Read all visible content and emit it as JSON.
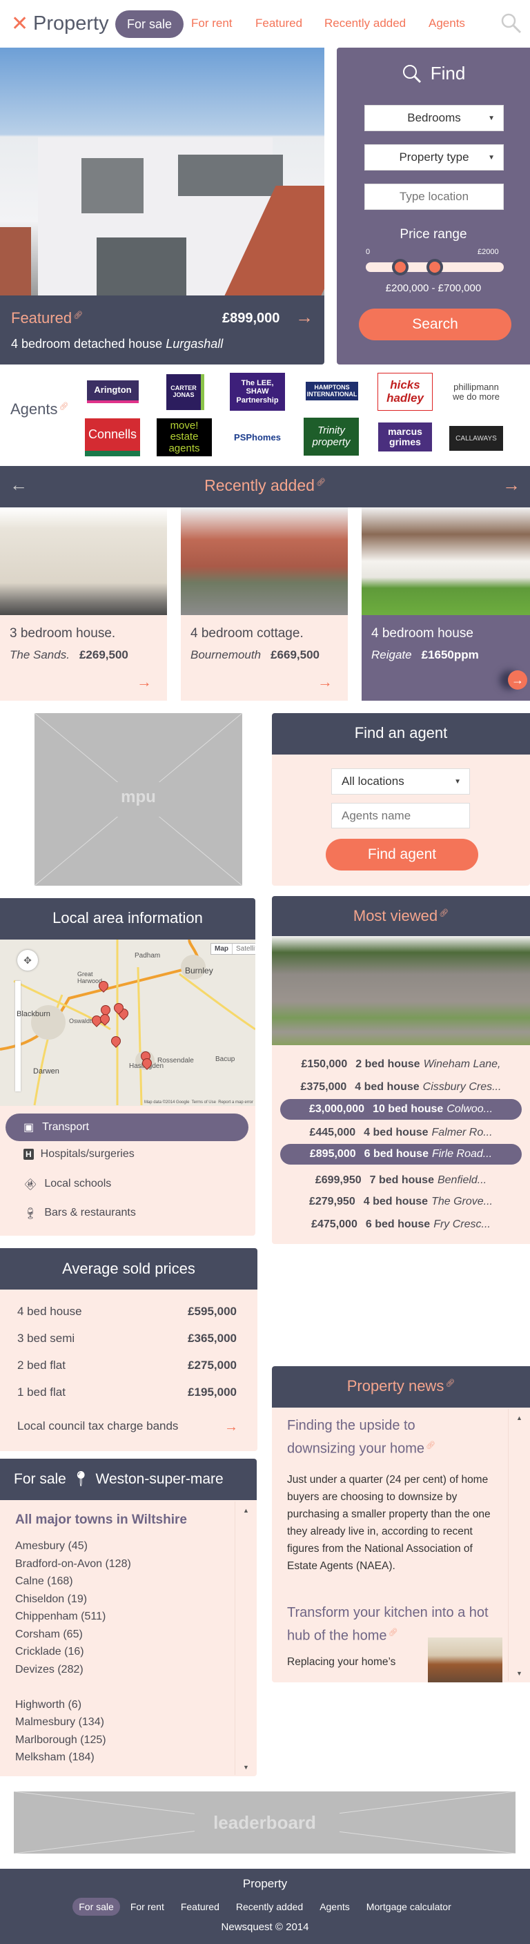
{
  "colors": {
    "navy": "#464b5f",
    "purple": "#6f6585",
    "coral": "#f47458",
    "peach": "#fdebe5",
    "salmon": "#f5a58d"
  },
  "header": {
    "logo_icon": "close-x-icon",
    "title": "Property",
    "nav": [
      {
        "label": "For sale",
        "active": true
      },
      {
        "label": "For rent"
      },
      {
        "label": "Featured"
      },
      {
        "label": "Recently added"
      },
      {
        "label": "Agents"
      }
    ],
    "search_icon": "search-icon"
  },
  "featured": {
    "label": "Featured",
    "price": "£899,000",
    "title": "4 bedroom detached house",
    "location": "Lurgashall"
  },
  "find": {
    "title": "Find",
    "bedrooms": "Bedrooms",
    "property_type": "Property type",
    "location_placeholder": "Type location",
    "price_range_label": "Price range",
    "min_label": "0",
    "max_label": "£2000",
    "range_text": "£200,000 - £700,000",
    "range_low_fraction": 0.25,
    "range_high_fraction": 0.5,
    "search_label": "Search"
  },
  "agents": {
    "label": "Agents",
    "logos": [
      "Arington",
      "CARTER JONAS",
      "The LEE, SHAW Partnership",
      "HAMPTONS INTERNATIONAL",
      "hicks hadley",
      "phillipmann we do more",
      "Connells",
      "move! estate agents",
      "PSPhomes",
      "Trinity property",
      "marcus grimes",
      "CALLAWAYS"
    ]
  },
  "recent": {
    "title": "Recently added",
    "cards": [
      {
        "title": "3 bedroom house.",
        "location": "The Sands.",
        "price": "£269,500"
      },
      {
        "title": "4 bedroom cottage.",
        "location": "Bournemouth",
        "price": "£669,500"
      },
      {
        "title": "4 bedroom house",
        "location": "Reigate",
        "price": "£1650ppm",
        "active": true
      }
    ]
  },
  "mpu": {
    "label": "mpu"
  },
  "find_agent": {
    "title": "Find an agent",
    "location": "All locations",
    "name_placeholder": "Agents name",
    "button": "Find agent"
  },
  "local": {
    "title": "Local area information",
    "map_places": [
      "Padham",
      "Burnley",
      "Blackburn",
      "Darwen",
      "Rossendale",
      "Haslingden",
      "Oswaldtwistle",
      "Great Harwood",
      "Bacup"
    ],
    "map_buttons": [
      "Map",
      "Satellite"
    ],
    "map_credit": "Map data ©2014 Google  Terms of Use  Report a map error",
    "items": [
      {
        "label": "Transport",
        "icon": "bus-icon",
        "active": true
      },
      {
        "label": "Hospitals/surgeries",
        "icon": "hospital-icon"
      },
      {
        "label": "Local schools",
        "icon": "school-children-icon"
      },
      {
        "label": "Bars & restaurants",
        "icon": "bottle-glass-icon"
      }
    ]
  },
  "most_viewed": {
    "title": "Most viewed",
    "rows": [
      {
        "price": "£150,000",
        "type": "2 bed house",
        "place": "Wineham Lane,"
      },
      {
        "price": "£375,000",
        "type": "4 bed house",
        "place": "Cissbury Cres..."
      },
      {
        "price": "£3,000,000",
        "type": "10 bed house",
        "place": "Colwoo...",
        "highlight": true
      },
      {
        "price": "£445,000",
        "type": "4 bed house",
        "place": "Falmer Ro..."
      },
      {
        "price": "£895,000",
        "type": "6 bed house",
        "place": "Firle Road...",
        "highlight": true
      },
      {
        "price": "£699,950",
        "type": "7 bed house",
        "place": "Benfield..."
      },
      {
        "price": "£279,950",
        "type": "4 bed house",
        "place": "The Grove..."
      },
      {
        "price": "£475,000",
        "type": "6 bed house",
        "place": "Fry Cresc..."
      }
    ]
  },
  "avg": {
    "title": "Average sold prices",
    "rows": [
      {
        "label": "4 bed house",
        "value": "£595,000"
      },
      {
        "label": "3 bed semi",
        "value": "£365,000"
      },
      {
        "label": "2 bed flat",
        "value": "£275,000"
      },
      {
        "label": "1 bed flat",
        "value": "£195,000"
      }
    ],
    "council": "Local council tax charge bands"
  },
  "for_sale": {
    "prefix": "For sale",
    "location": "Weston-super-mare",
    "heading": "All major towns in Wiltshire",
    "towns": [
      "Amesbury (45)",
      "Bradford-on-Avon (128)",
      "Calne (168)",
      "Chiseldon (19)",
      "Chippenham (511)",
      "Corsham (65)",
      "Cricklade (16)",
      "Devizes (282)",
      "",
      "Highworth (6)",
      "Malmesbury (134)",
      "Marlborough (125)",
      "Melksham (184)"
    ]
  },
  "news": {
    "title": "Property news",
    "articles": [
      {
        "title": "Finding the upside to downsizing your home",
        "body": "Just under a quarter (24 per cent) of home buyers are choosing to downsize by purchasing a smaller property than the one they already live in, according to recent figures from the National Association of Estate Agents (NAEA)."
      },
      {
        "title": "Transform your kitchen into a hot hub of the home",
        "body": "Replacing your home’s"
      }
    ]
  },
  "leaderboard": {
    "label": "leaderboard"
  },
  "footer": {
    "title": "Property",
    "links": [
      {
        "label": "For sale",
        "active": true
      },
      {
        "label": "For rent"
      },
      {
        "label": "Featured"
      },
      {
        "label": "Recently added"
      },
      {
        "label": "Agents"
      },
      {
        "label": "Mortgage calculator"
      }
    ],
    "copyright": "Newsquest © 2014"
  }
}
